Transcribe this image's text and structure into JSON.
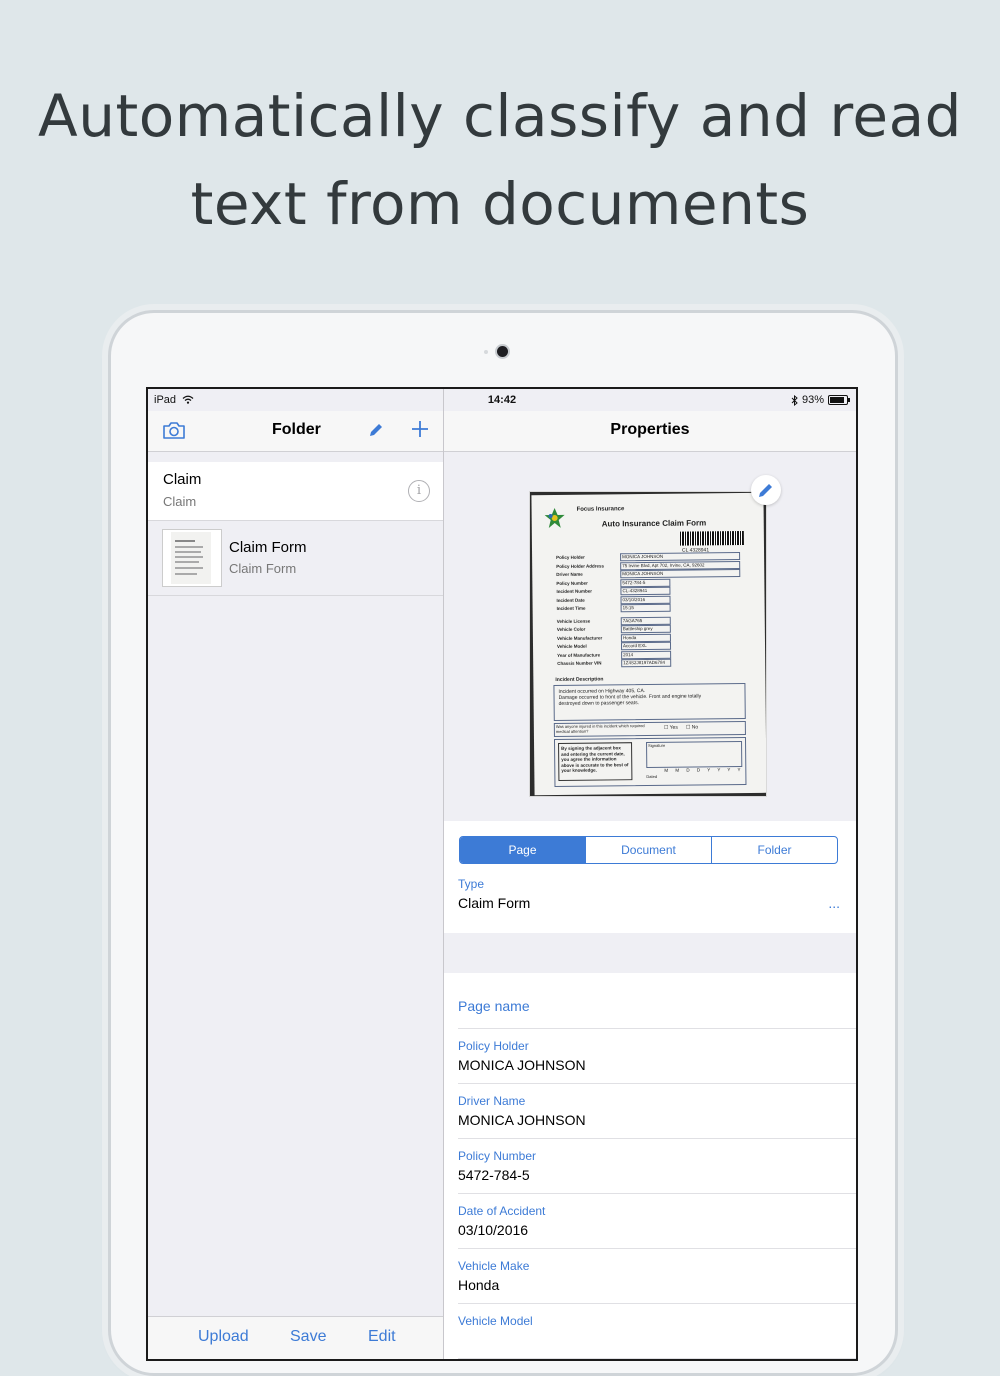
{
  "headline": {
    "line1": "Automatically classify and read",
    "line2": "text from documents"
  },
  "status_bar": {
    "device": "iPad",
    "time": "14:42",
    "battery": "93%"
  },
  "left_pane": {
    "title": "Folder",
    "icons": [
      "camera-icon",
      "pencil-icon",
      "plus-icon"
    ],
    "items": [
      {
        "title": "Claim",
        "subtitle": "Claim"
      },
      {
        "title": "Claim Form",
        "subtitle": "Claim Form"
      }
    ],
    "toolbar": {
      "upload": "Upload",
      "save": "Save",
      "edit": "Edit"
    }
  },
  "right_pane": {
    "title": "Properties",
    "document_image": {
      "company": "Focus Insurance",
      "form_title": "Auto Insurance Claim Form",
      "barcode_text": "CL 4328941",
      "rows": [
        {
          "label": "Policy Holder",
          "value": "MONICA JOHNSON"
        },
        {
          "label": "Policy Holder Address",
          "value": "75 Irvine Blvd, Apt 702, Irvine, CA, 92602"
        },
        {
          "label": "Driver Name",
          "value": "MONICA JOHNSON"
        },
        {
          "label": "Policy Number",
          "value": "5472-784-5"
        },
        {
          "label": "Incident Number",
          "value": "CL-4328941"
        },
        {
          "label": "Incident Date",
          "value": "03/10/2016"
        },
        {
          "label": "Incident Time",
          "value": "15:15"
        },
        {
          "label": "Vehicle License",
          "value": "7AGA765"
        },
        {
          "label": "Vehicle Color",
          "value": "Battleship grey"
        },
        {
          "label": "Vehicle Manufacturer",
          "value": "Honda"
        },
        {
          "label": "Vehicle Model",
          "value": "Accord EXL"
        },
        {
          "label": "Year of Manufacture",
          "value": "2014"
        },
        {
          "label": "Chassis Number VIN",
          "value": "1Z4S2J8197AD6784"
        }
      ],
      "incident_label": "Incident Description",
      "incident_text1": "Incident occurred on Highway 405, CA.",
      "incident_text2": "Damage occurred to front of the vehicle. Front and engine totally",
      "incident_text3": "destroyed down to passenger seats.",
      "injury_question": "Was anyone injured in this incident which required medical attention?",
      "yes": "Yes",
      "no": "No",
      "sign_text": "By signing the adjacent box and entering the current date, you agree the information above is accurate to the best of your knowledge.",
      "signature": "Signature",
      "dated": "Dated",
      "date_format": "M M D D Y Y Y Y"
    },
    "segments": [
      "Page",
      "Document",
      "Folder"
    ],
    "active_segment": "Page",
    "type_label": "Type",
    "type_value": "Claim Form",
    "more": "...",
    "page_name_label": "Page name",
    "fields": [
      {
        "label": "Policy Holder",
        "value": "MONICA JOHNSON"
      },
      {
        "label": "Driver Name",
        "value": "MONICA JOHNSON"
      },
      {
        "label": "Policy Number",
        "value": "5472-784-5"
      },
      {
        "label": "Date of Accident",
        "value": "03/10/2016"
      },
      {
        "label": "Vehicle Make",
        "value": "Honda"
      },
      {
        "label": "Vehicle Model",
        "value": ""
      }
    ]
  },
  "colors": {
    "accent": "#3d7bd6",
    "background": "#dfe7ea",
    "headline": "#333a3d"
  }
}
